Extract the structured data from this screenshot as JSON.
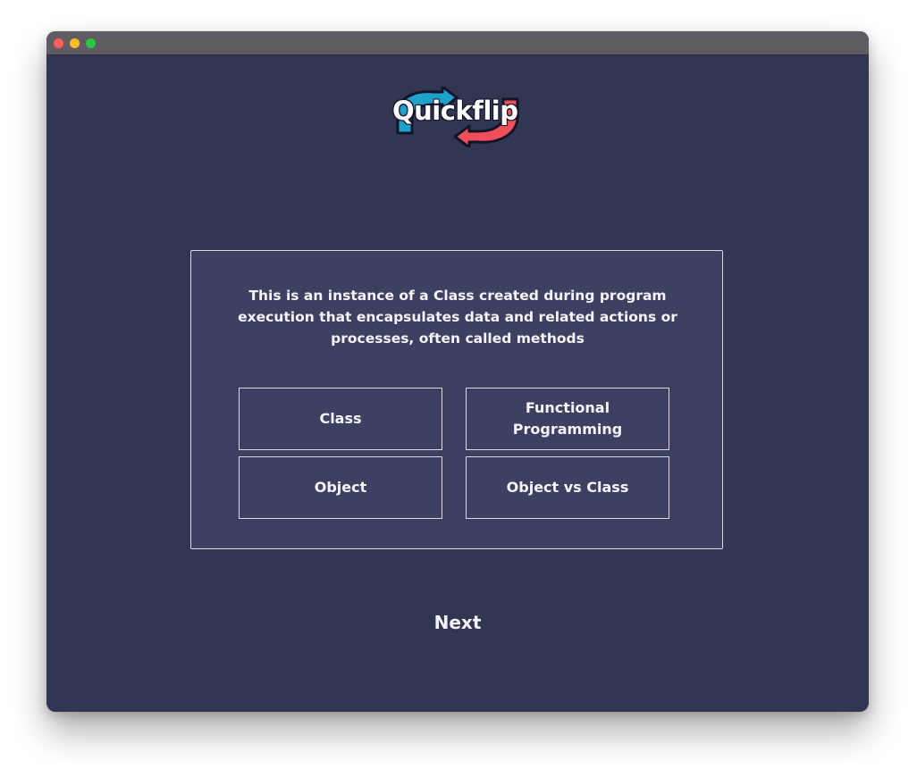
{
  "window": {
    "controls": [
      {
        "name": "close",
        "color": "#fe5f57"
      },
      {
        "name": "minimize",
        "color": "#febc2e"
      },
      {
        "name": "zoom",
        "color": "#28c840"
      }
    ]
  },
  "logo": {
    "text": "Quickflip",
    "colors": {
      "blue": "#1fa2c9",
      "red": "#ef4e5a",
      "outline": "#12142a"
    }
  },
  "quiz": {
    "question": "This is an instance of a Class created during program execution that encapsulates data and related actions or processes, often called methods",
    "options": [
      {
        "label": "Class"
      },
      {
        "label": "Functional Programming"
      },
      {
        "label": "Object"
      },
      {
        "label": "Object vs Class"
      }
    ]
  },
  "navigation": {
    "next_label": "Next"
  },
  "theme": {
    "background": "#333652",
    "card": "#3d4060",
    "border": "#d9d9e4",
    "text": "#f4f4f8"
  }
}
